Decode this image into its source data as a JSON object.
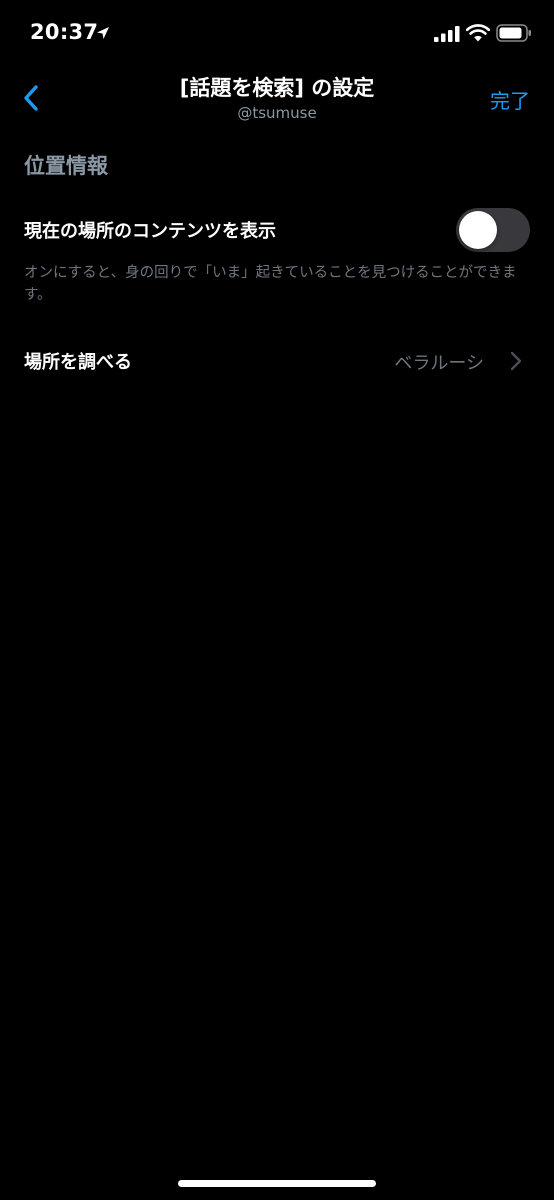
{
  "status_bar": {
    "time": "20:37",
    "icons": [
      "location-arrow-icon",
      "signal-icon",
      "wifi-icon",
      "battery-icon"
    ]
  },
  "nav": {
    "title": "[話題を検索] の設定",
    "subtitle": "@tsumuse",
    "done_label": "完了",
    "back_icon": "chevron-left-icon"
  },
  "section": {
    "header": "位置情報",
    "toggle": {
      "label": "現在の場所のコンテンツを表示",
      "state": "off",
      "description": "オンにすると、身の回りで「いま」起きていることを見つけることができます。"
    },
    "location_row": {
      "label": "場所を調べる",
      "value": "ベラルーシ",
      "icon": "chevron-right-icon"
    }
  },
  "colors": {
    "background": "#000000",
    "accent": "#1d9bf0",
    "secondary_text": "#8b98a5",
    "muted_text": "#6e767d",
    "toggle_track_off": "#39393d"
  }
}
